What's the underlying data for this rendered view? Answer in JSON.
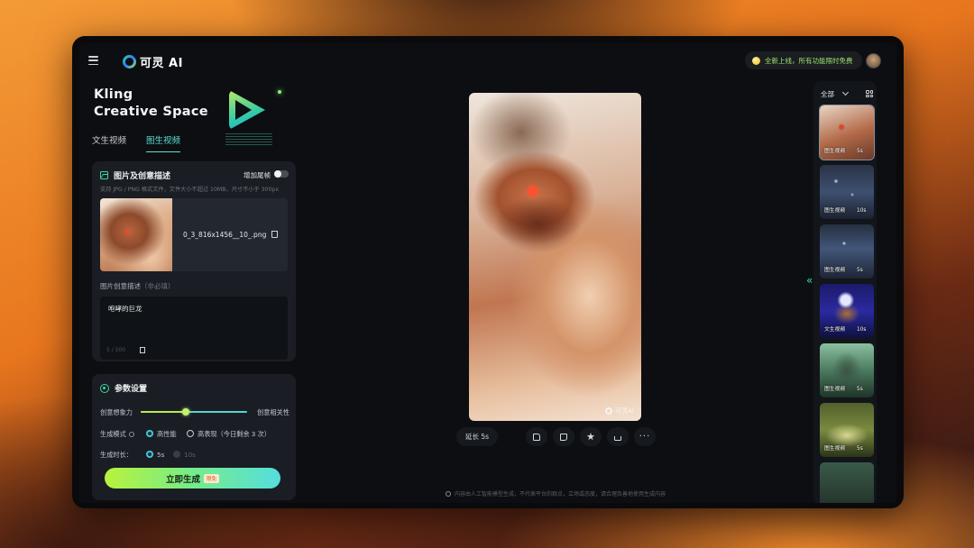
{
  "topbar": {
    "brand": "可灵 AI",
    "promo": "全新上线，所有功能限时免费"
  },
  "hero": {
    "title_line1": "Kling",
    "title_line2": "Creative Space"
  },
  "tabs": [
    {
      "label": "文生视频",
      "active": false
    },
    {
      "label": "图生视频",
      "active": true
    }
  ],
  "image_card": {
    "title": "图片及创意描述",
    "tail_frame_label": "增加尾帧",
    "tail_frame_enabled": false,
    "hint": "支持 JPG / PNG 格式文件，文件大小不超过 10MB，尺寸不小于 300px",
    "file_name": "0_3_816x1456__10_.png",
    "desc_label": "图片创意描述",
    "desc_optional": "（非必填）",
    "desc_value": "咆哮的巨龙",
    "desc_count": "5 / 500"
  },
  "params": {
    "title": "参数设置",
    "slider_left": "创意想象力",
    "slider_right": "创意相关性",
    "slider_value": 0.42,
    "mode_label": "生成模式",
    "mode_options": [
      {
        "label": "高性能",
        "selected": true
      },
      {
        "label": "高表现（今日剩余 3 次）",
        "selected": false
      }
    ],
    "duration_label": "生成时长：",
    "duration_options": [
      {
        "label": "5s",
        "selected": true
      },
      {
        "label": "10s",
        "selected": false,
        "disabled": true
      }
    ]
  },
  "generate": {
    "label": "立即生成",
    "badge": "限免"
  },
  "preview": {
    "watermark": "可灵AI",
    "extend_label": "延长 5s",
    "more_label": "···"
  },
  "footer": {
    "disclaimer": "内容由人工智能模型生成，不代表平台的观点，立场或态度，请合理及善地使用生成内容"
  },
  "history": {
    "filter": "全部",
    "items": [
      {
        "type": "图生视频",
        "duration": "5s",
        "selected": true
      },
      {
        "type": "图生视频",
        "duration": "10s",
        "selected": false
      },
      {
        "type": "图生视频",
        "duration": "5s",
        "selected": false
      },
      {
        "type": "文生视频",
        "duration": "10s",
        "selected": false
      },
      {
        "type": "图生视频",
        "duration": "5s",
        "selected": false
      },
      {
        "type": "图生视频",
        "duration": "5s",
        "selected": false
      },
      {
        "type": "",
        "duration": "",
        "selected": false
      }
    ]
  },
  "colors": {
    "accent": "#3ed6a6",
    "tab_active": "#5fe0d0",
    "promo_text": "#9fe870"
  }
}
